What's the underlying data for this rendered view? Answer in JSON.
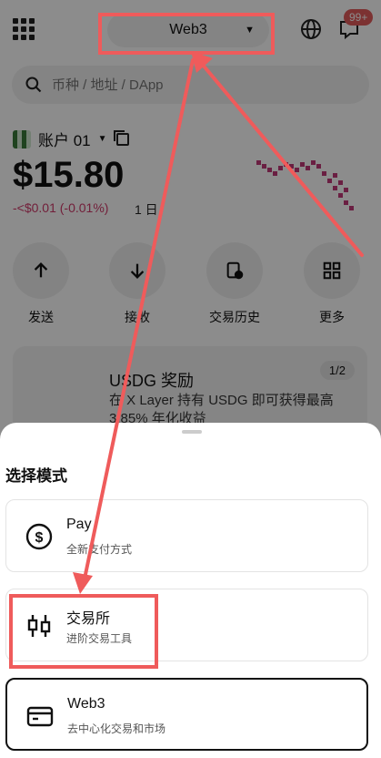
{
  "header": {
    "mode_label": "Web3",
    "badge": "99+"
  },
  "search": {
    "placeholder": "币种 / 地址 / DApp"
  },
  "account": {
    "name": "账户 01"
  },
  "balance": {
    "amount": "$15.80",
    "change": "-<$0.01 (-0.01%)",
    "period": "1 日"
  },
  "actions": [
    {
      "label": "发送",
      "icon": "arrow-up-icon"
    },
    {
      "label": "接收",
      "icon": "arrow-down-icon"
    },
    {
      "label": "交易历史",
      "icon": "history-icon"
    },
    {
      "label": "更多",
      "icon": "grid-icon"
    }
  ],
  "promo": {
    "title": "USDG 奖励",
    "desc": "在 X Layer 持有 USDG 即可获得最高 3.85% 年化收益",
    "page": "1/2"
  },
  "sheet": {
    "title": "选择模式",
    "options": [
      {
        "title": "Pay",
        "desc": "全新支付方式",
        "icon": "dollar-icon"
      },
      {
        "title": "交易所",
        "desc": "进阶交易工具",
        "icon": "candlestick-icon"
      },
      {
        "title": "Web3",
        "desc": "去中心化交易和市场",
        "icon": "wallet-card-icon"
      }
    ]
  },
  "colors": {
    "annotation": "#ef5b5b",
    "negative": "#d03a6a",
    "sparkline": "#c23a78"
  }
}
